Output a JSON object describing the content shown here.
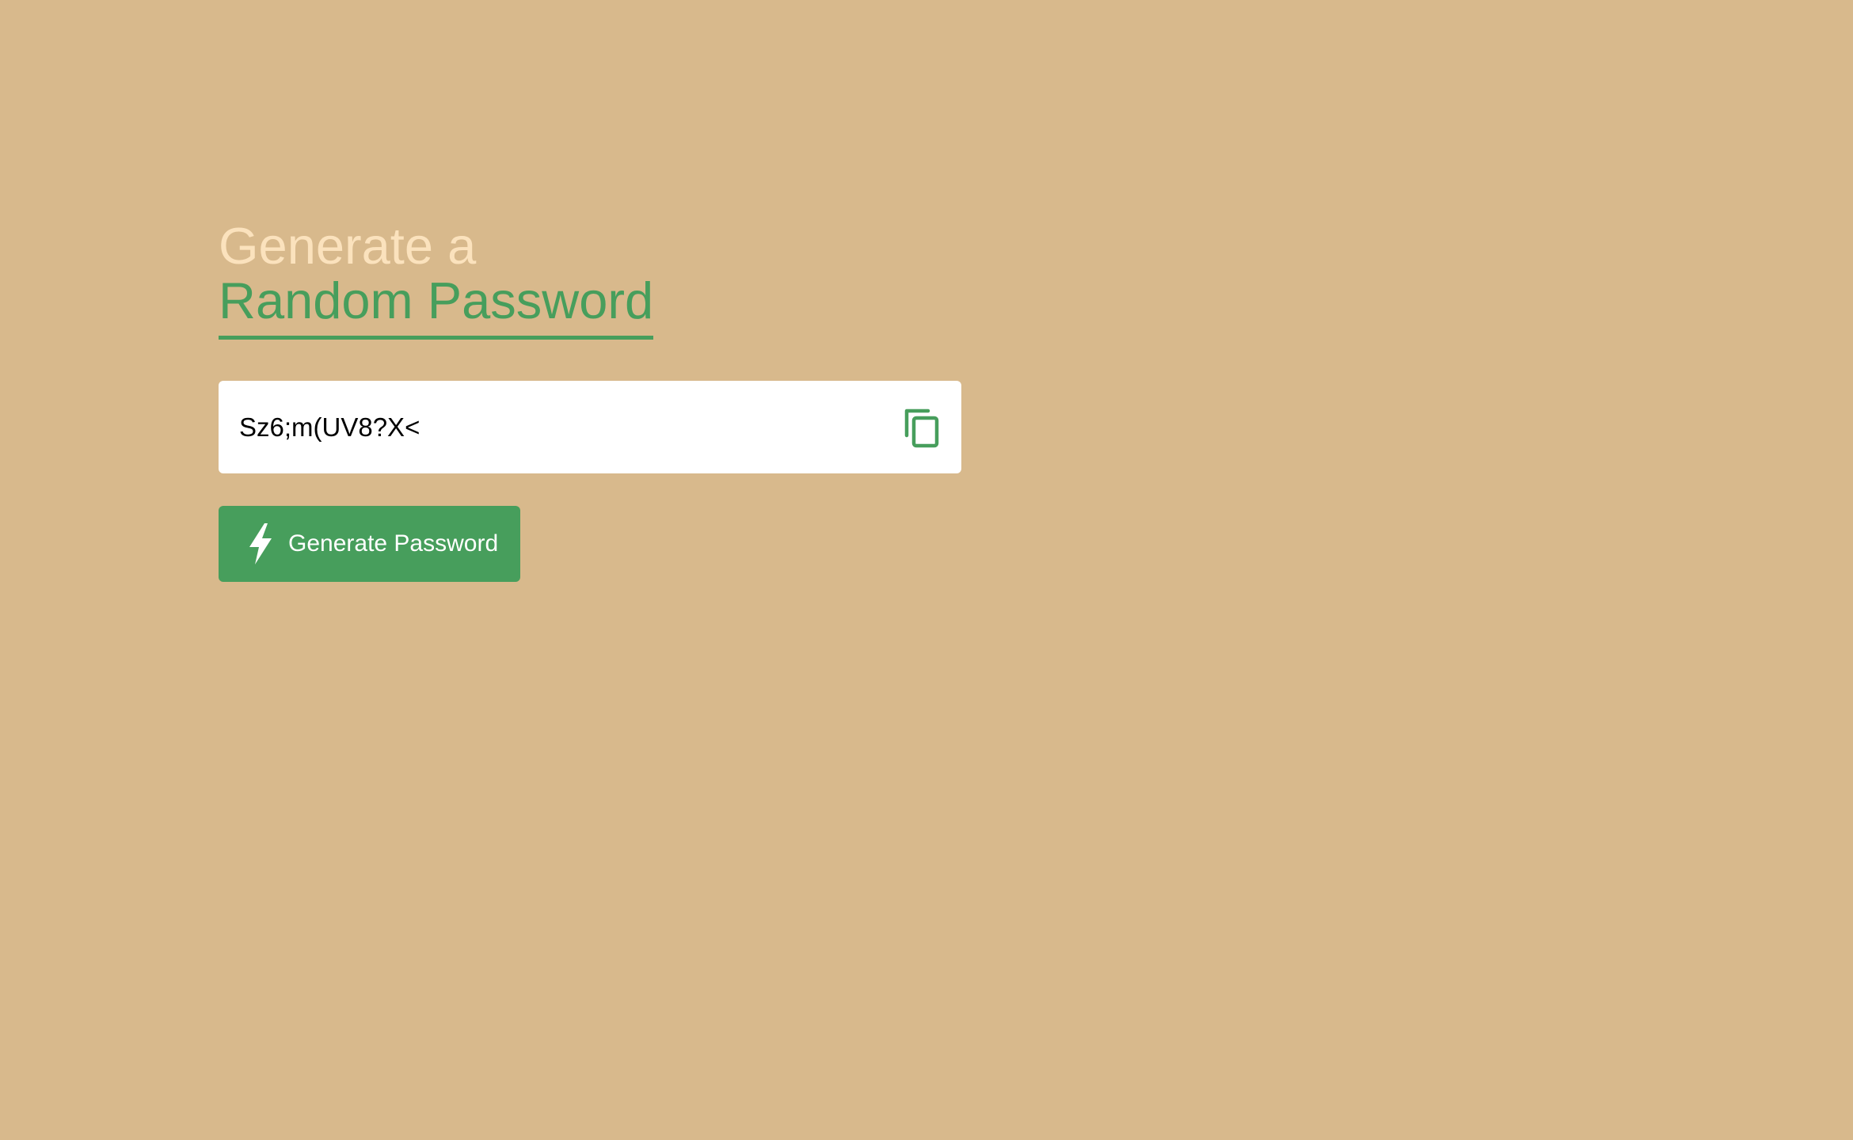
{
  "heading": {
    "line1": "Generate a",
    "line2": "Random Password"
  },
  "password": {
    "value": "Sz6;m(UV8?X<"
  },
  "copy_button": {
    "icon": "copy-icon"
  },
  "generate_button": {
    "label": "Generate Password",
    "icon": "lightning-bolt-icon"
  },
  "colors": {
    "background": "#d8b98c",
    "accent": "#479e5c",
    "heading_light": "#fbe2bd",
    "input_bg": "#ffffff"
  }
}
